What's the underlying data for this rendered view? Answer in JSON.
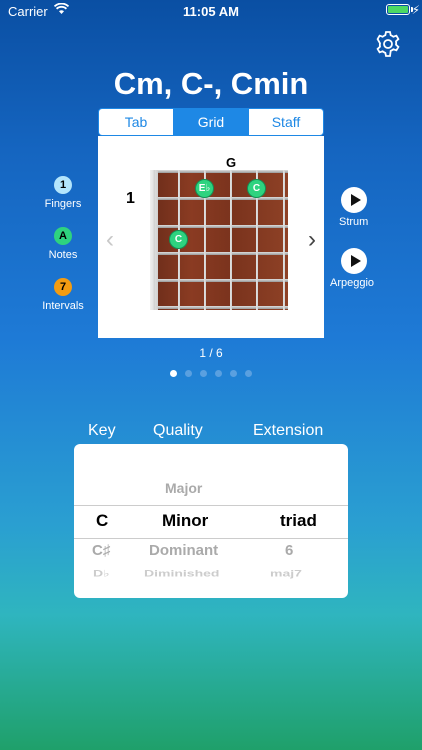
{
  "status": {
    "carrier": "Carrier",
    "time": "11:05 AM"
  },
  "title": "Cm, C-, Cmin",
  "tabs": [
    "Tab",
    "Grid",
    "Staff"
  ],
  "diagram": {
    "fret_number": "1",
    "open_string_label": "G",
    "notes": [
      "E♭",
      "C",
      "C"
    ]
  },
  "side_left": [
    {
      "symbol": "1",
      "label": "Fingers",
      "color": "#b3e5fc"
    },
    {
      "symbol": "A",
      "label": "Notes",
      "color": "#2ed37f"
    },
    {
      "symbol": "7",
      "label": "Intervals",
      "color": "#f39c12"
    }
  ],
  "side_right": {
    "strum": "Strum",
    "arpeggio": "Arpeggio"
  },
  "nav": {
    "prev": "‹",
    "next": "›"
  },
  "pager": {
    "text": "1 / 6"
  },
  "columns": {
    "key": "Key",
    "quality": "Quality",
    "extension": "Extension"
  },
  "picker": {
    "key": {
      "selected": "C",
      "after": [
        "C♯",
        "D♭"
      ]
    },
    "quality": {
      "before": [
        "Major"
      ],
      "selected": "Minor",
      "after": [
        "Dominant",
        "Diminished"
      ]
    },
    "extension": {
      "selected": "triad",
      "after": [
        "6",
        "maj7"
      ]
    }
  }
}
